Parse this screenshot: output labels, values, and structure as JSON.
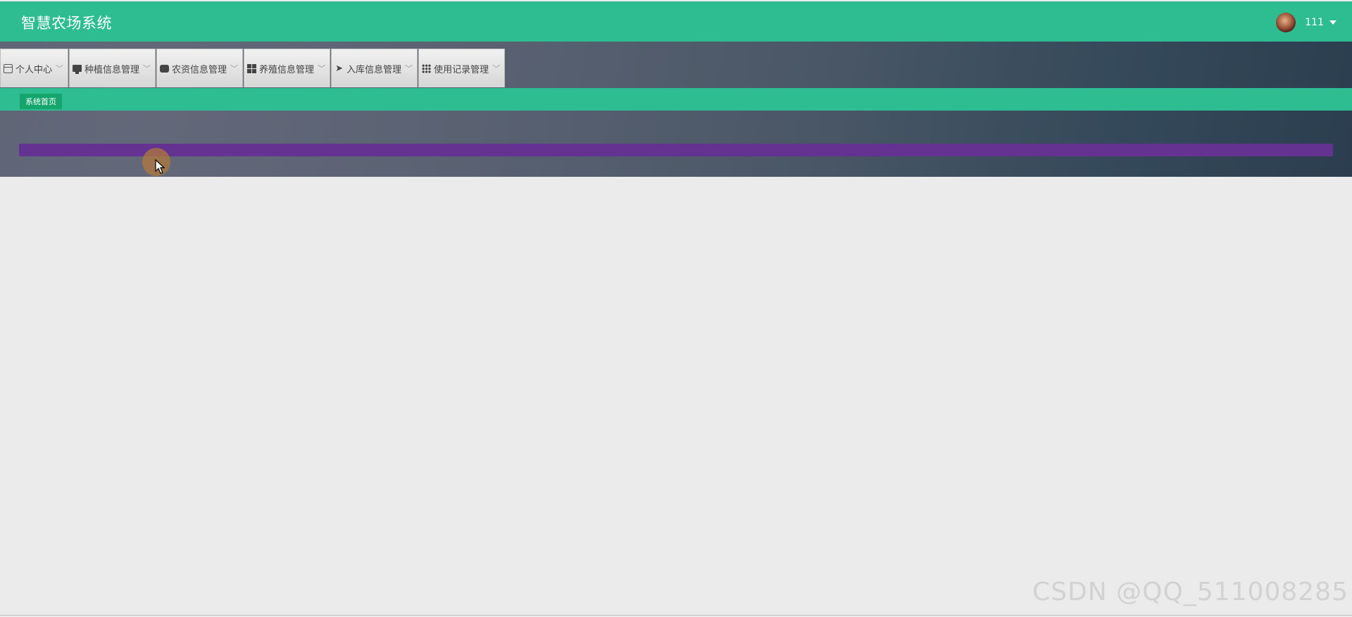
{
  "app": {
    "title": "智慧农场系统",
    "username": "111"
  },
  "nav": {
    "items": [
      {
        "label": "个人中心",
        "icon": "card-icon"
      },
      {
        "label": "种植信息管理",
        "icon": "monitor-icon"
      },
      {
        "label": "农资信息管理",
        "icon": "hard-drive-icon"
      },
      {
        "label": "养殖信息管理",
        "icon": "grid-four-icon"
      },
      {
        "label": "入库信息管理",
        "icon": "paper-plane-icon"
      },
      {
        "label": "使用记录管理",
        "icon": "grid-nine-icon"
      }
    ]
  },
  "breadcrumb": {
    "current": "系统首页"
  },
  "watermark": "CSDN @QQ_511008285",
  "colors": {
    "primary": "#2ebc91",
    "crumb": "#16a56d",
    "progress": "#643391",
    "background": "#ebebeb"
  }
}
